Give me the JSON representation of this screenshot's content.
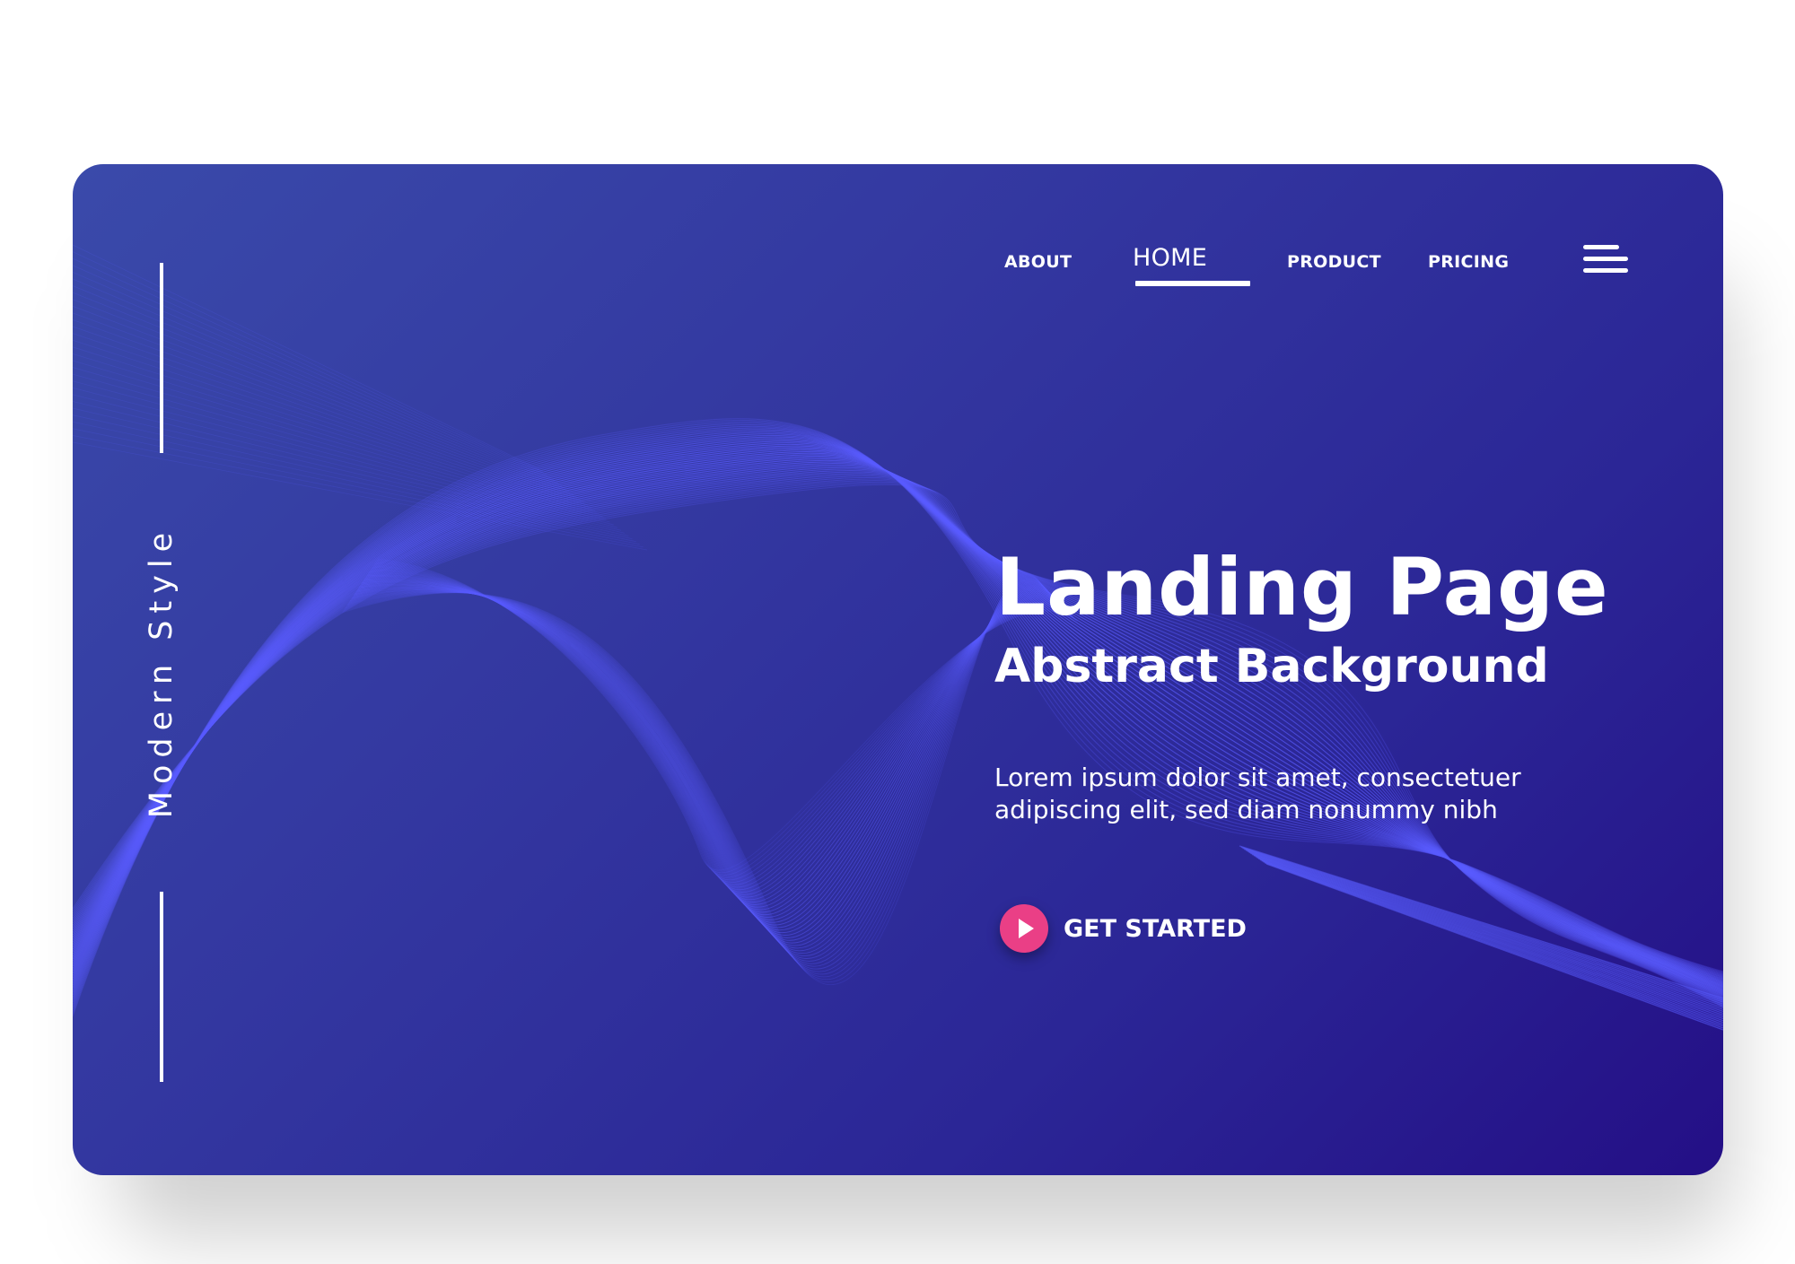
{
  "nav": {
    "items": [
      {
        "label": "ABOUT"
      },
      {
        "label": "HOME",
        "active": true
      },
      {
        "label": "PRODUCT"
      },
      {
        "label": "PRICING"
      }
    ],
    "menu_icon": "hamburger-menu-icon"
  },
  "side": {
    "vertical_text": "Modern Style"
  },
  "hero": {
    "title": "Landing Page",
    "subtitle": "Abstract Background",
    "body": "Lorem ipsum dolor sit amet, consectetuer adipiscing elit, sed diam nonummy nibh",
    "cta_label": "GET STARTED",
    "cta_icon": "play-icon"
  },
  "colors": {
    "page_background": "#ffffff",
    "card_gradient_start": "#3a4aaa",
    "card_gradient_end": "#240f86",
    "wave_lines": "#5a5cff",
    "cta_accent": "#ea3f86",
    "text": "#ffffff"
  }
}
